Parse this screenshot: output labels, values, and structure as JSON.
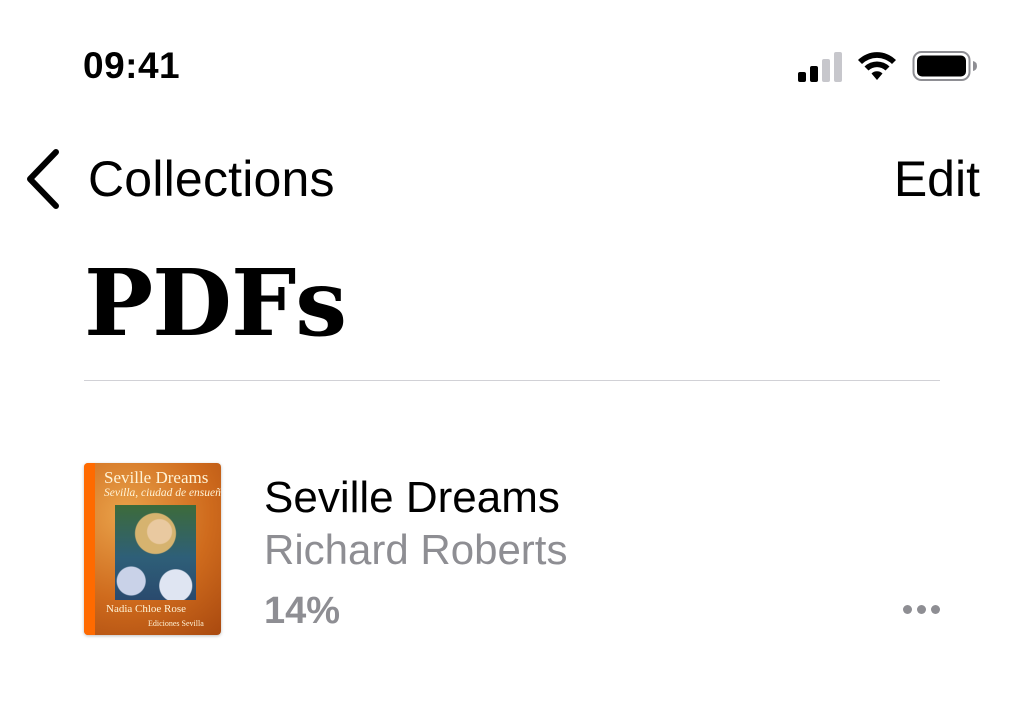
{
  "status_bar": {
    "time": "09:41",
    "icons": [
      "cellular-signal-icon",
      "wifi-icon",
      "battery-icon"
    ]
  },
  "nav": {
    "back_label": "Collections",
    "edit_label": "Edit"
  },
  "page_title": "PDFs",
  "books": [
    {
      "title": "Seville Dreams",
      "author": "Richard Roberts",
      "progress": "14%",
      "cover": {
        "title": "Seville Dreams",
        "subtitle": "Sevilla, ciudad de ensueño",
        "author": "Nadia Chloe Rose",
        "publisher": "Ediciones Sevilla"
      }
    }
  ],
  "colors": {
    "secondary_text": "#8e8e93",
    "divider": "#d1d1d6",
    "cover_spine": "#ff6a00"
  }
}
